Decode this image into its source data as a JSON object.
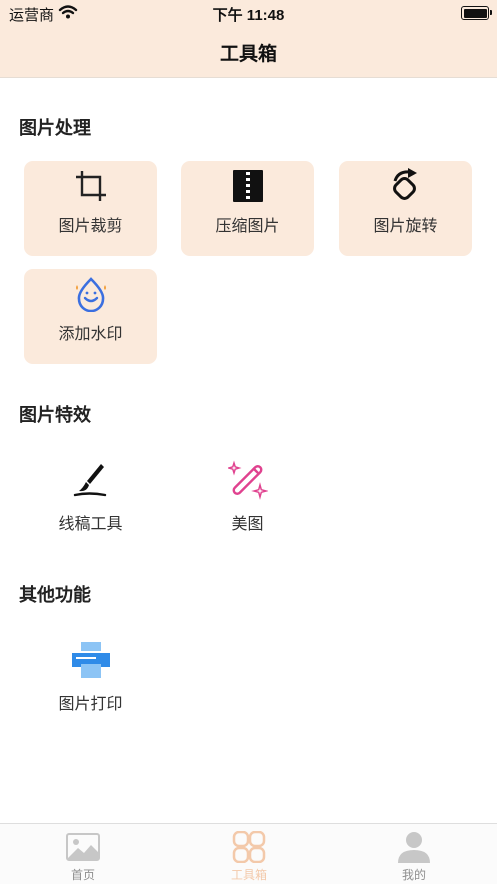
{
  "status_bar": {
    "carrier": "运营商",
    "time": "下午 11:48"
  },
  "nav": {
    "title": "工具箱"
  },
  "sections": [
    {
      "title": "图片处理",
      "items": [
        {
          "label": "图片裁剪",
          "icon": "crop-icon"
        },
        {
          "label": "压缩图片",
          "icon": "zip-file-icon"
        },
        {
          "label": "图片旋转",
          "icon": "rotate-icon"
        },
        {
          "label": "添加水印",
          "icon": "water-drop-icon"
        }
      ]
    },
    {
      "title": "图片特效",
      "items": [
        {
          "label": "线稿工具",
          "icon": "brush-icon"
        },
        {
          "label": "美图",
          "icon": "magic-wand-icon"
        }
      ]
    },
    {
      "title": "其他功能",
      "items": [
        {
          "label": "图片打印",
          "icon": "printer-icon"
        }
      ]
    }
  ],
  "tabs": [
    {
      "label": "首页",
      "icon": "image-icon",
      "active": false
    },
    {
      "label": "工具箱",
      "icon": "toolbox-icon",
      "active": true
    },
    {
      "label": "我的",
      "icon": "user-icon",
      "active": false
    }
  ],
  "colors": {
    "accent_bg": "#fbeadc",
    "active_tab": "#f3c9aa",
    "magic_pink": "#e0428f",
    "drop_blue": "#3b6fe0",
    "printer_blue": "#2f8be8"
  }
}
